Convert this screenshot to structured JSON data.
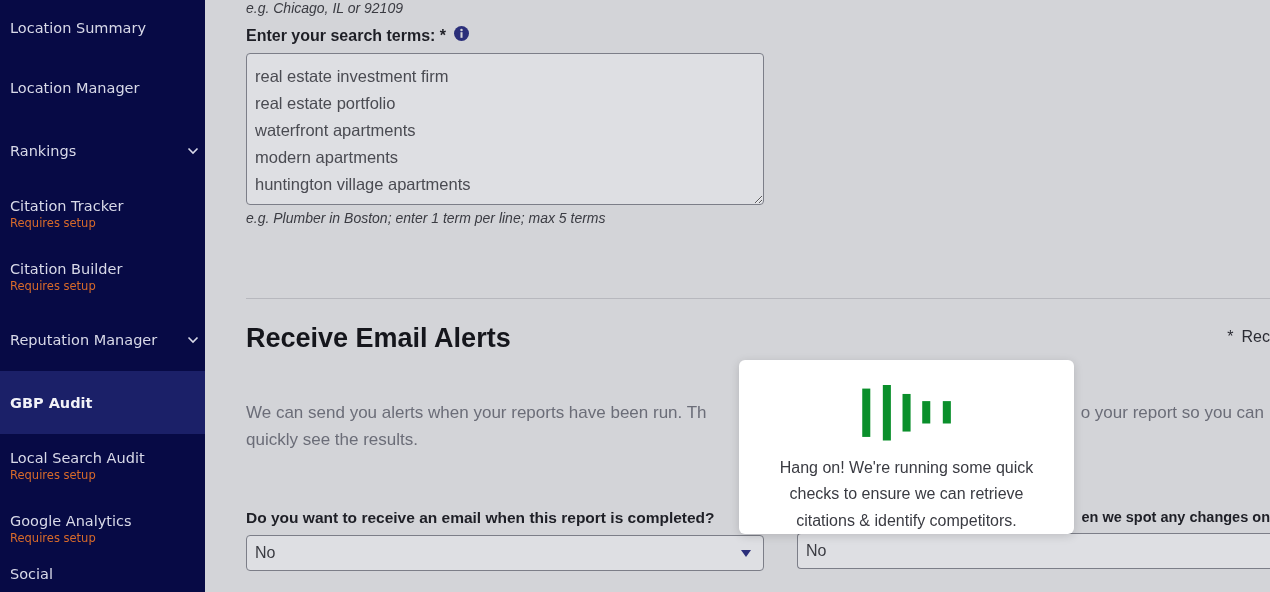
{
  "sidebar": {
    "items": [
      {
        "label": "Location Summary",
        "submenu": false,
        "selected": false
      },
      {
        "label": "Location Manager",
        "submenu": false,
        "selected": false
      },
      {
        "label": "Rankings",
        "submenu": true,
        "selected": false
      },
      {
        "label": "Citation Tracker",
        "sublabel": "Requires setup",
        "submenu": false,
        "selected": false
      },
      {
        "label": "Citation Builder",
        "sublabel": "Requires setup",
        "submenu": false,
        "selected": false
      },
      {
        "label": "Reputation Manager",
        "submenu": true,
        "selected": false
      },
      {
        "label": "GBP Audit",
        "submenu": false,
        "selected": true
      },
      {
        "label": "Local Search Audit",
        "sublabel": "Requires setup",
        "submenu": false,
        "selected": false
      },
      {
        "label": "Google Analytics",
        "sublabel": "Requires setup",
        "submenu": false,
        "selected": false
      },
      {
        "label": "Social",
        "submenu": false,
        "selected": false
      }
    ]
  },
  "location_hint": "e.g. Chicago, IL or 92109",
  "search_terms": {
    "label": "Enter your search terms: *",
    "value": [
      "real estate investment firm",
      "real estate portfolio",
      "waterfront apartments",
      "modern apartments",
      "huntington village apartments"
    ],
    "hint": "e.g. Plumber in Boston; enter 1 term per line; max 5 terms"
  },
  "alerts": {
    "title": "Receive Email Alerts",
    "required_note": [
      "*",
      "Rec"
    ],
    "description": {
      "line_1_left": "We can send you alerts when your reports have been run. Th",
      "line_1_right": "o your report so you can",
      "line_2": "quickly see the results."
    },
    "questions": [
      {
        "label": "Do you want to receive an email when this report is completed?",
        "value": "No",
        "caret": true
      },
      {
        "label": "en we spot any changes on",
        "value": "No",
        "caret": false
      }
    ]
  },
  "modal": {
    "message": "Hang on! We're running some quick checks to ensure we can retrieve citations & identify competitors."
  }
}
